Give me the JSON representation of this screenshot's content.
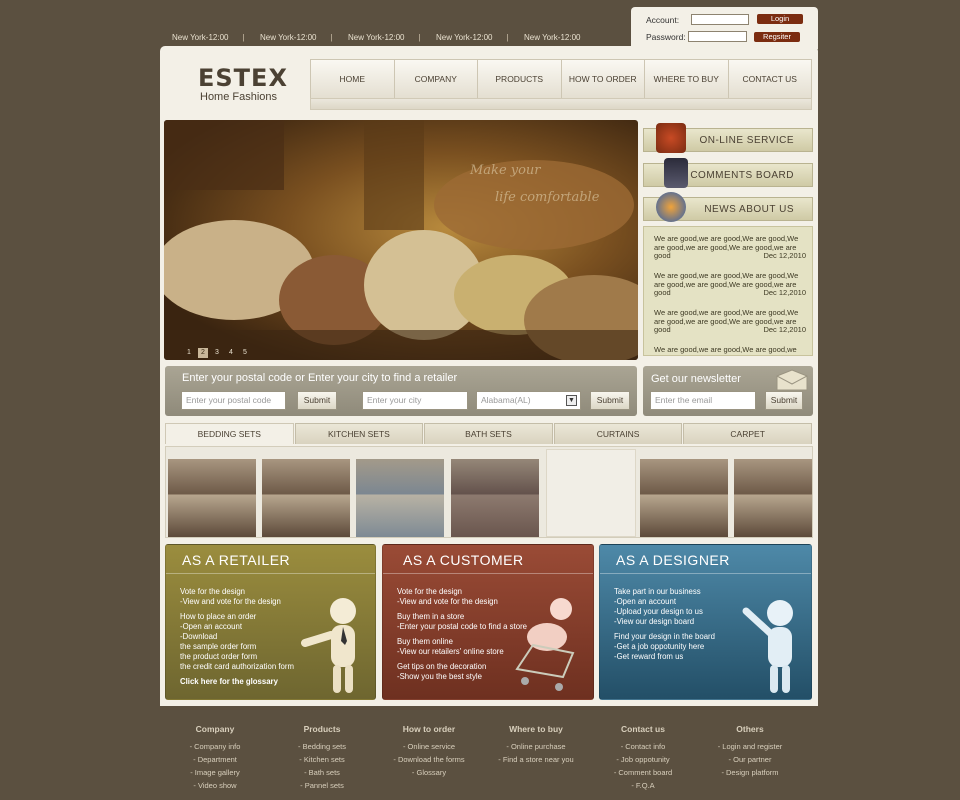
{
  "clocks": [
    "New York-12:00",
    "New York-12:00",
    "New York-12:00",
    "New York-12:00",
    "New York-12:00"
  ],
  "clock_sep": "|",
  "login": {
    "account_label": "Account:",
    "password_label": "Password:",
    "login_button": "Login",
    "register_button": "Regsiter"
  },
  "brand": {
    "logo": "ESTEX",
    "tagline": "Home Fashions"
  },
  "nav": [
    "HOME",
    "COMPANY",
    "PRODUCTS",
    "HOW TO ORDER",
    "WHERE TO BUY",
    "CONTACT US"
  ],
  "hero": {
    "overlay_text_1": "Make your",
    "overlay_text_2": "life comfortable",
    "slides": [
      "1",
      "2",
      "3",
      "4",
      "5"
    ],
    "active_slide": 2
  },
  "services": [
    {
      "label": "ON-LINE SERVICE",
      "icon": "phone-service-icon"
    },
    {
      "label": "COMMENTS BOARD",
      "icon": "message-board-icon"
    },
    {
      "label": "NEWS ABOUT US",
      "icon": "news-globe-icon"
    }
  ],
  "news": [
    {
      "text": "We are good,we are good,We are good,We are good,we are good,We are good,we are good",
      "date": "Dec 12,2010"
    },
    {
      "text": "We are good,we are good,We are good,We are good,we are good,We are good,we are good",
      "date": "Dec 12,2010"
    },
    {
      "text": "We are good,we are good,We are good,We are good,we are good,We are good,we are good",
      "date": "Dec 12,2010"
    },
    {
      "text": "We are good,we are good,We are good,we are",
      "date": ""
    }
  ],
  "retailer_search": {
    "title": "Enter your postal code  or  Enter your city to find a retailer",
    "postal_placeholder": "Enter your postal code",
    "submit": "Submit",
    "city_placeholder": "Enter your city",
    "state_selected": "Alabama(AL)",
    "submit_2": "Submit"
  },
  "newsletter": {
    "title": "Get our newsletter",
    "email_placeholder": "Enter the email",
    "submit": "Submit"
  },
  "product_tabs": [
    "BEDDING SETS",
    "KITCHEN SETS",
    "BATH SETS",
    "CURTAINS",
    "CARPET"
  ],
  "panels": [
    {
      "title": "AS A RETAILER",
      "color": "#8e8139",
      "lines": [
        "Vote for the design",
        "-View and vote for the design",
        "How to place an order",
        "-Open an account",
        "-Download",
        "the sample order form",
        "the product order form",
        "the credit card authorization form",
        "Click here for the glossary"
      ]
    },
    {
      "title": "AS A CUSTOMER",
      "color": "#8f4330",
      "lines": [
        "Vote for the design",
        "-View and vote for the design",
        "Buy them in a store",
        "-Enter your postal code to find a store",
        "Buy them online",
        "-View our retailers' online store",
        "Get tips on the decoration",
        "-Show you the best style"
      ]
    },
    {
      "title": "AS A DESIGNER",
      "color": "#2f6b8c",
      "lines": [
        "Take part in our business",
        "-Open an account",
        "-Upload your design to us",
        "-View our design board",
        "Find your design in the board",
        "-Get a job oppotunity here",
        "-Get reward from us"
      ]
    }
  ],
  "footer": [
    {
      "heading": "Company",
      "links": [
        "- Company info",
        "- Department",
        "- Image gallery",
        "- Video show"
      ]
    },
    {
      "heading": "Products",
      "links": [
        "- Bedding sets",
        "- Kitchen sets",
        "- Bath sets",
        "- Pannel sets"
      ]
    },
    {
      "heading": "How to order",
      "links": [
        "- Online service",
        "- Download the forms",
        "- Glossary"
      ]
    },
    {
      "heading": "Where to buy",
      "links": [
        "- Online purchase",
        "- Find a store near you"
      ]
    },
    {
      "heading": "Contact us",
      "links": [
        "- Contact info",
        "- Job oppotunity",
        "- Comment board",
        "- F.Q.A"
      ]
    },
    {
      "heading": "Others",
      "links": [
        "- Login and register",
        "- Our partner",
        "- Design platform"
      ]
    }
  ]
}
